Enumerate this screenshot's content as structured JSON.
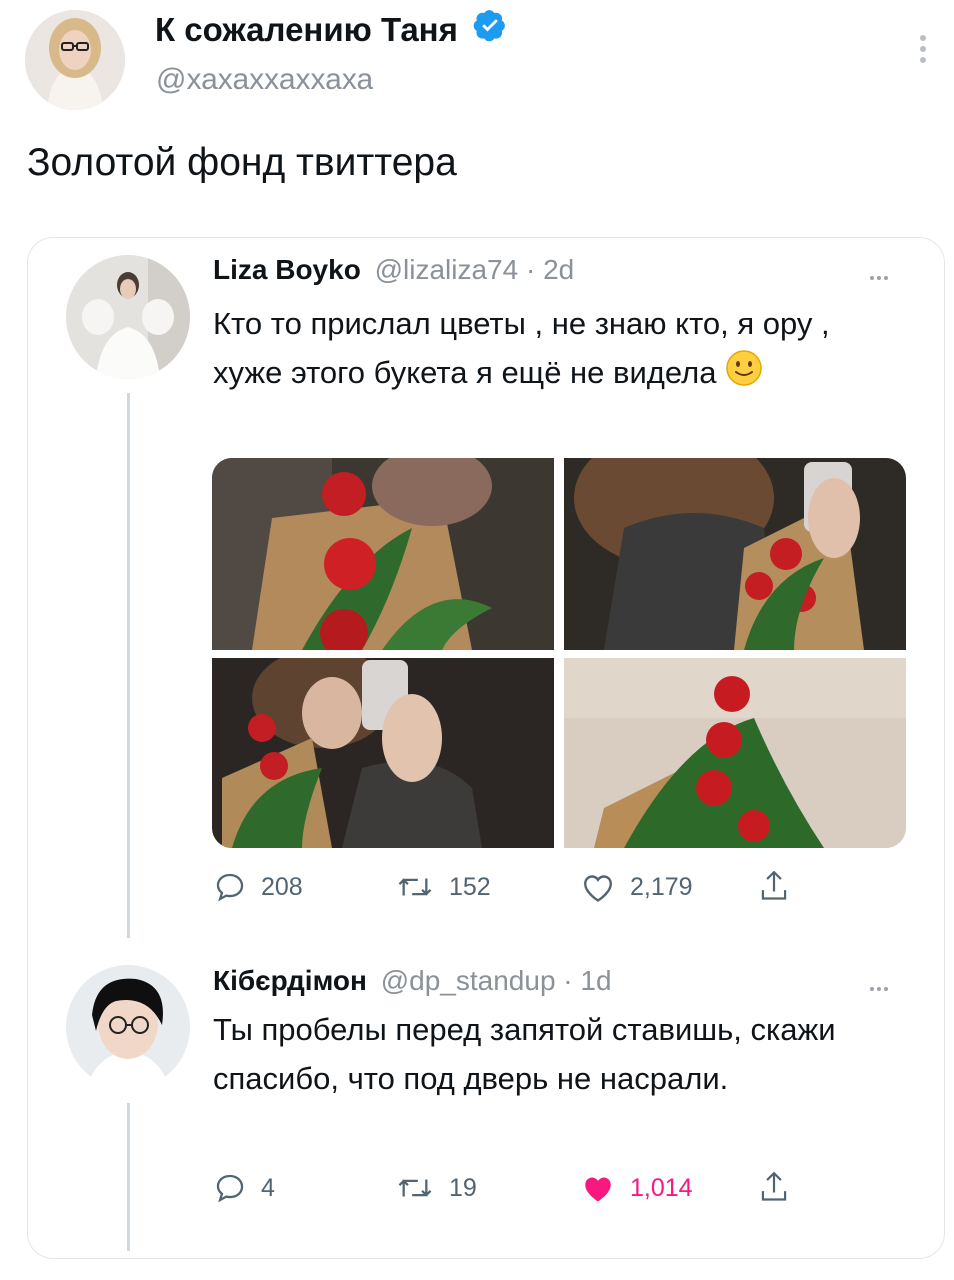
{
  "main_tweet": {
    "author_name": "К сожалению Таня",
    "handle": "@хахаххаххаха",
    "text": "Золотой фонд твиттера",
    "verified": true,
    "verified_color": "#1d9bf0"
  },
  "quoted_thread": {
    "tweets": [
      {
        "author_name": "Liza Boyko",
        "handle_time": "@lizaliza74 · 2d",
        "text": "Кто то прислал цветы , не знаю кто, я ору , хуже этого букета я ещё не видела",
        "emoji": "slightly-smiling-face",
        "photos": [
          "roses-photo-1",
          "roses-photo-2",
          "roses-photo-3",
          "roses-photo-4"
        ],
        "stats": {
          "replies": "208",
          "retweets": "152",
          "likes": "2,179"
        },
        "liked": false
      },
      {
        "author_name": "Кібєрдімон",
        "handle_time": "@dp_standup · 1d",
        "text": "Ты пробелы перед запятой ставишь, скажи спасибо, что под дверь не насрали.",
        "stats": {
          "replies": "4",
          "retweets": "19",
          "likes": "1,014"
        },
        "liked": true,
        "like_color": "#f91880"
      }
    ]
  }
}
